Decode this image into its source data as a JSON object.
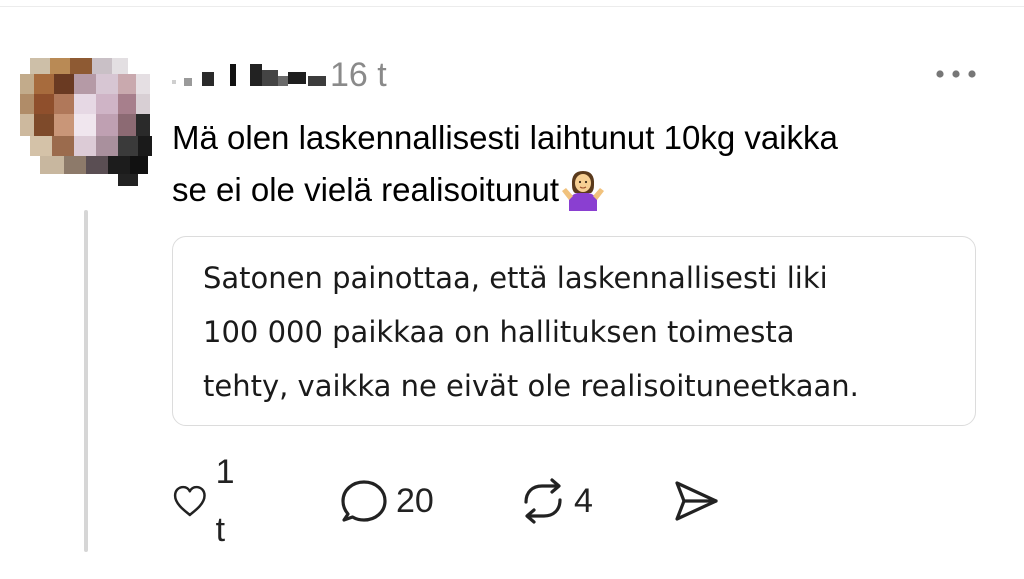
{
  "post": {
    "timestamp": "16 t",
    "text_lines": [
      "Mä olen laskennallisesti laihtunut 10kg vaikka",
      "se ei ole vielä realisoitunut"
    ],
    "emoji": "woman-shrugging-icon"
  },
  "quote": {
    "lines": [
      "Satonen painottaa, että laskennallisesti liki",
      "100 000 paikkaa on hallituksen toimesta",
      "tehty, vaikka ne eivät ole realisoituneetkaan."
    ]
  },
  "actions": {
    "like_count": "1 t",
    "reply_count": "20",
    "repost_count": "4"
  },
  "icons": {
    "like": "heart-icon",
    "reply": "comment-icon",
    "repost": "repost-icon",
    "share": "send-icon",
    "more": "more-dots-icon"
  },
  "colors": {
    "timestamp": "#8a8a8a",
    "quote_border": "#dcdcdc",
    "thread_line": "#d6d6d6",
    "emoji_shirt": "#8a3fd1"
  }
}
